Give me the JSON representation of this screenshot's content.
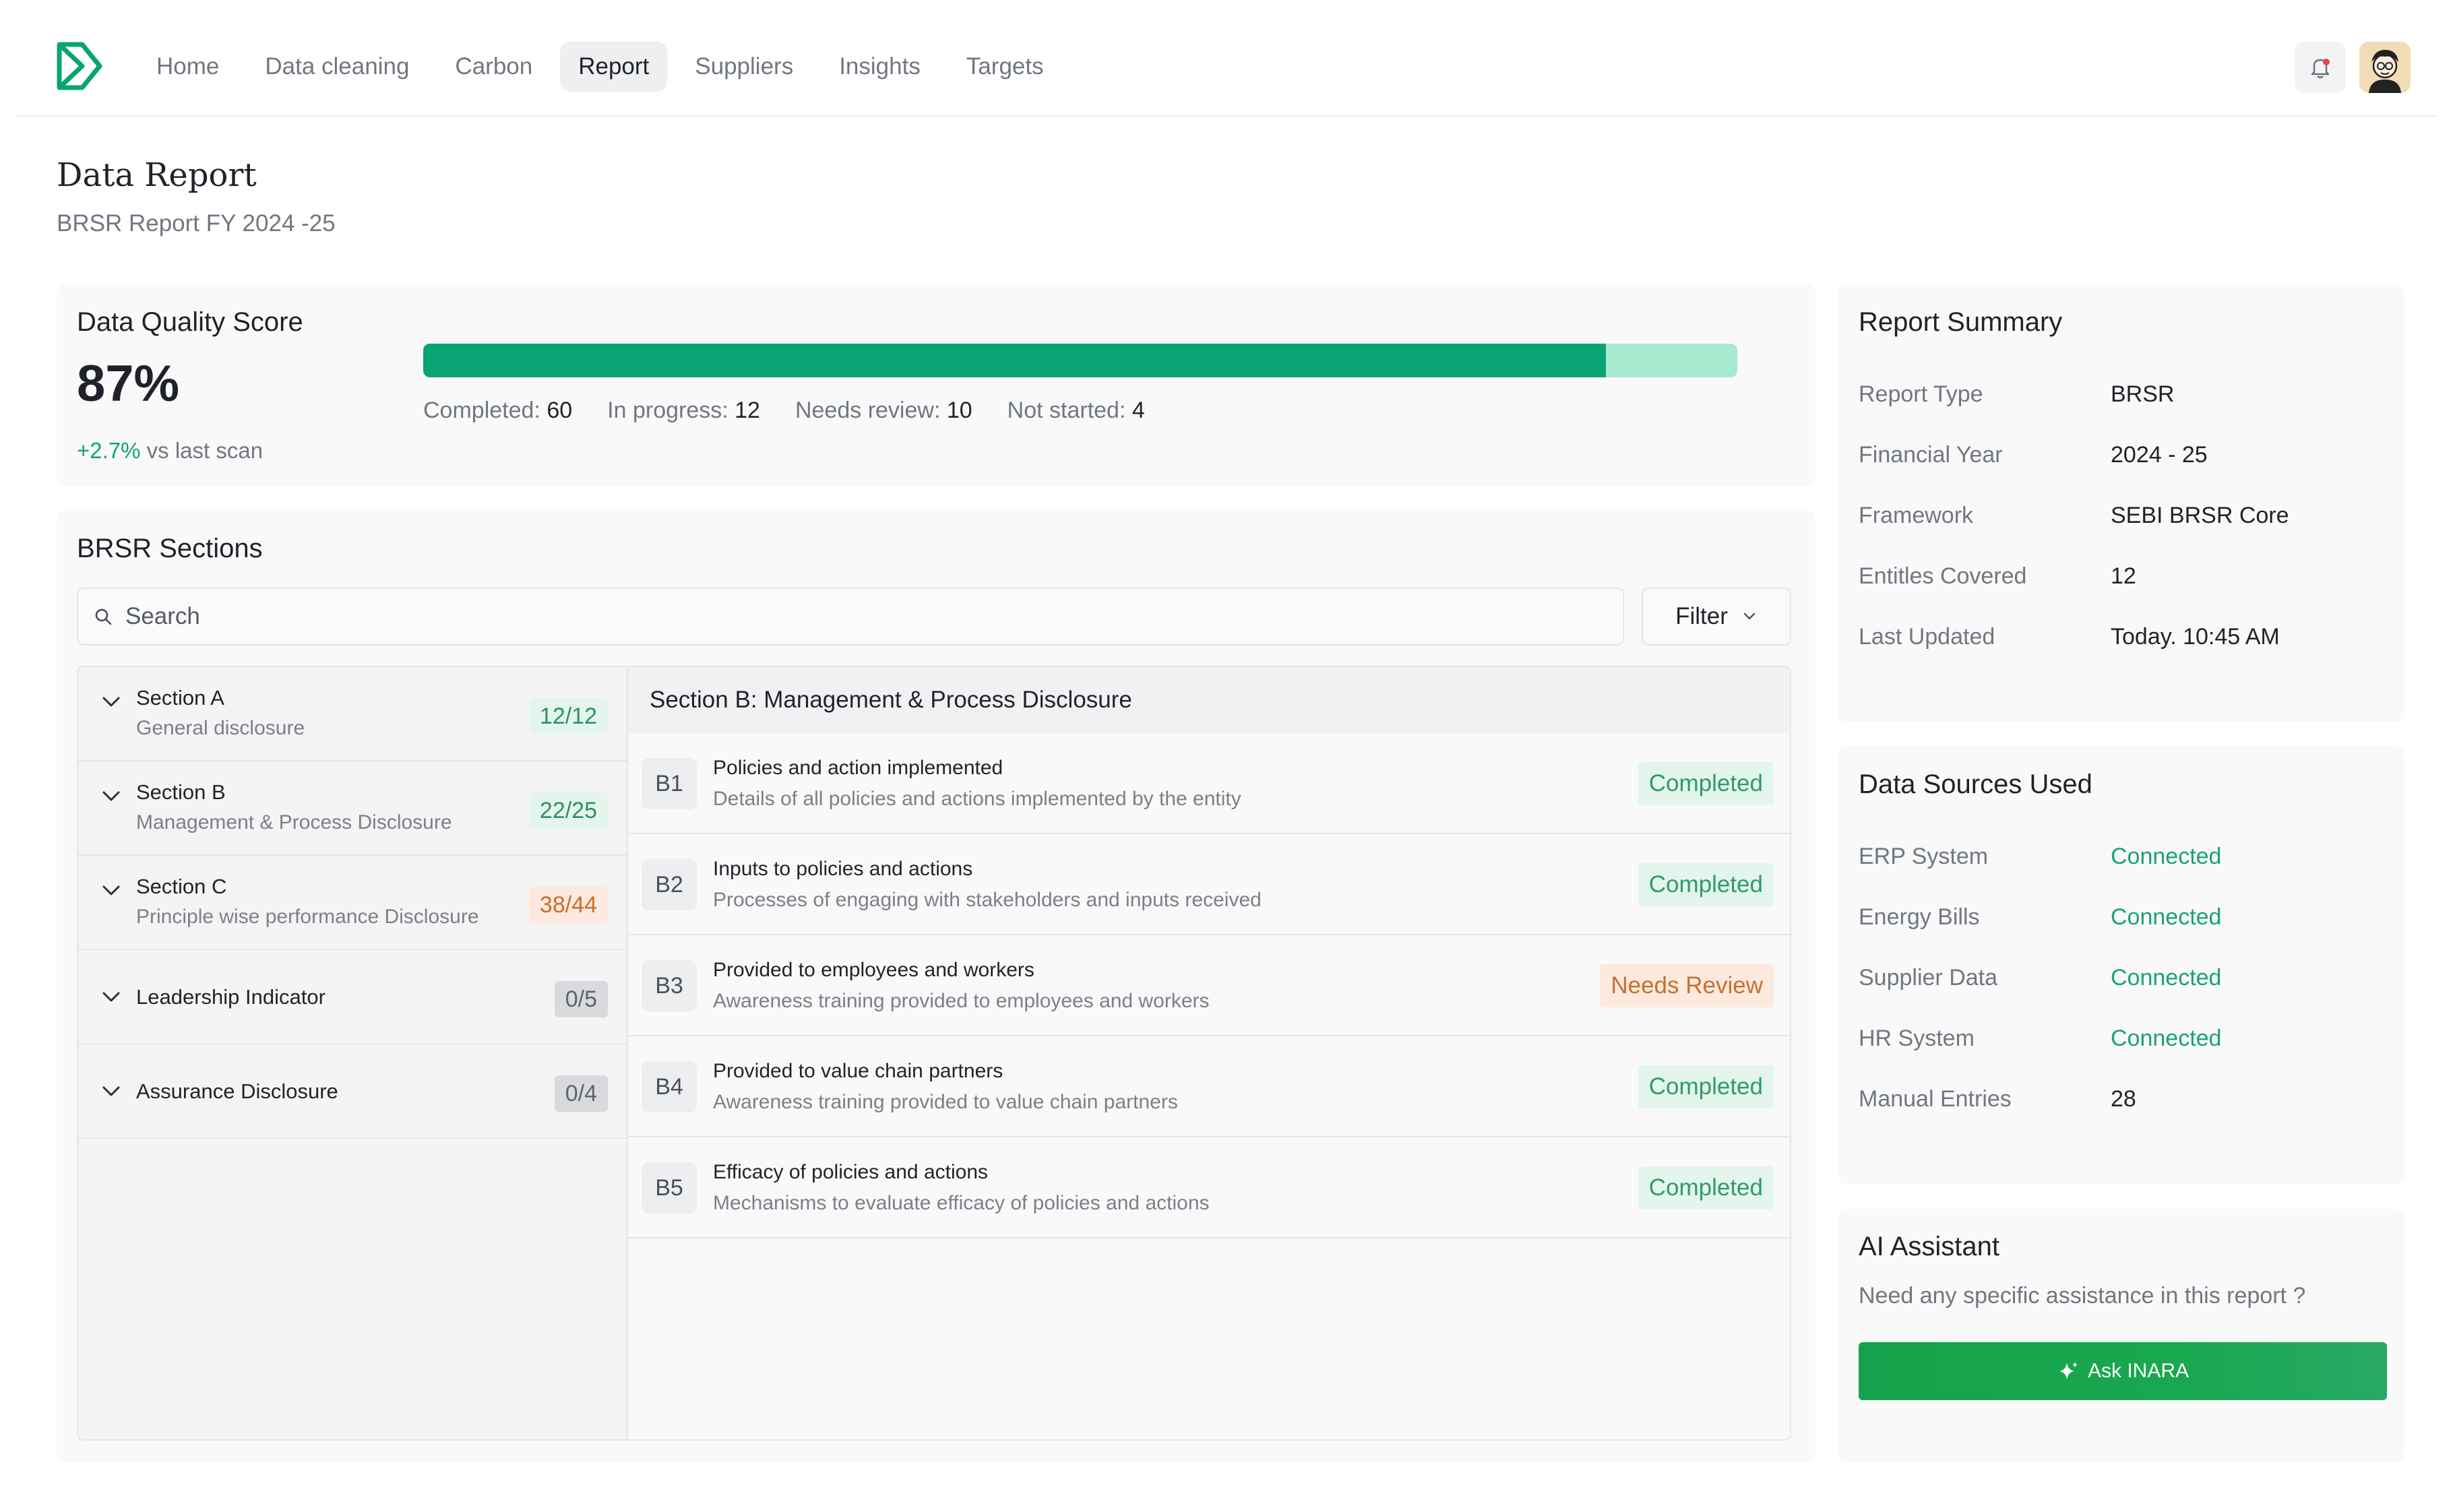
{
  "nav": {
    "items": [
      {
        "label": "Home",
        "name": "nav-home"
      },
      {
        "label": "Data cleaning",
        "name": "nav-data-cleaning"
      },
      {
        "label": "Carbon",
        "name": "nav-carbon"
      },
      {
        "label": "Report",
        "name": "nav-report",
        "active": true
      },
      {
        "label": "Suppliers",
        "name": "nav-suppliers"
      },
      {
        "label": "Insights",
        "name": "nav-insights"
      },
      {
        "label": "Targets",
        "name": "nav-targets"
      }
    ],
    "icons": {
      "logo": "logo-icon",
      "bell": "bell-icon",
      "avatar": "avatar"
    }
  },
  "header": {
    "title": "Data Report",
    "subtitle": "BRSR Report FY 2024 -25"
  },
  "data_quality": {
    "title": "Data Quality Score",
    "score": "87%",
    "change": "+2.7%",
    "change_suffix": " vs last scan",
    "progress": 0.9,
    "stats": {
      "completed_label": "Completed: ",
      "completed": "60",
      "in_progress_label": "In progress: ",
      "in_progress": "12",
      "needs_review_label": "Needs review: ",
      "needs_review": "10",
      "not_started_label": "Not started: ",
      "not_started": "4"
    }
  },
  "brsr": {
    "title": "BRSR Sections",
    "search_placeholder": "Search",
    "filter_label": "Filter",
    "sections": [
      {
        "name": "Section A",
        "desc": "General disclosure",
        "count": "12/12",
        "tone": "green"
      },
      {
        "name": "Section B",
        "desc": "Management & Process Disclosure",
        "count": "22/25",
        "tone": "green"
      },
      {
        "name": "Section C",
        "desc": "Principle wise performance Disclosure",
        "count": "38/44",
        "tone": "orange"
      },
      {
        "name": "Leadership Indicator",
        "desc": "",
        "count": "0/5",
        "tone": "gray"
      },
      {
        "name": "Assurance Disclosure",
        "desc": "",
        "count": "0/4",
        "tone": "gray"
      }
    ],
    "detail_title": "Section B: Management & Process Disclosure",
    "rows": [
      {
        "code": "B1",
        "title": "Policies and action implemented",
        "desc": "Details of all policies and actions implemented by the entity",
        "status": "Completed",
        "tone": "green"
      },
      {
        "code": "B2",
        "title": "Inputs to policies and actions",
        "desc": "Processes of engaging with stakeholders and inputs received",
        "status": "Completed",
        "tone": "green"
      },
      {
        "code": "B3",
        "title": "Provided to employees and workers",
        "desc": "Awareness training provided to employees and workers",
        "status": "Needs Review",
        "tone": "orange"
      },
      {
        "code": "B4",
        "title": "Provided to value chain partners",
        "desc": "Awareness training provided to value chain partners",
        "status": "Completed",
        "tone": "green"
      },
      {
        "code": "B5",
        "title": "Efficacy of policies and actions",
        "desc": "Mechanisms to evaluate efficacy of policies and actions",
        "status": "Completed",
        "tone": "green"
      }
    ]
  },
  "report_summary": {
    "title": "Report Summary",
    "items": [
      {
        "label": "Report Type",
        "value": "BRSR"
      },
      {
        "label": "Financial Year",
        "value": "2024 - 25"
      },
      {
        "label": "Framework",
        "value": "SEBI BRSR Core"
      },
      {
        "label": "Entitles Covered",
        "value": "12"
      },
      {
        "label": "Last Updated",
        "value": "Today. 10:45 AM"
      }
    ]
  },
  "data_sources": {
    "title": "Data Sources Used",
    "items": [
      {
        "label": "ERP System",
        "value": "Connected",
        "connected": true
      },
      {
        "label": "Energy Bills",
        "value": "Connected",
        "connected": true
      },
      {
        "label": "Supplier Data",
        "value": "Connected",
        "connected": true
      },
      {
        "label": "HR System",
        "value": "Connected",
        "connected": true
      },
      {
        "label": "Manual Entries",
        "value": "28",
        "connected": false
      }
    ]
  },
  "ai_assistant": {
    "title": "AI  Assistant",
    "subtitle": "Need any specific assistance in this report ?",
    "button_label": "Ask INARA",
    "button_icon": "sparkle-icon"
  },
  "colors": {
    "accent": "#08a473",
    "progress_remaining": "#a7ead0",
    "status_green": "#2f9a6d",
    "status_orange": "#c7702d",
    "connected": "#18a46d",
    "button": "#16a24c"
  }
}
